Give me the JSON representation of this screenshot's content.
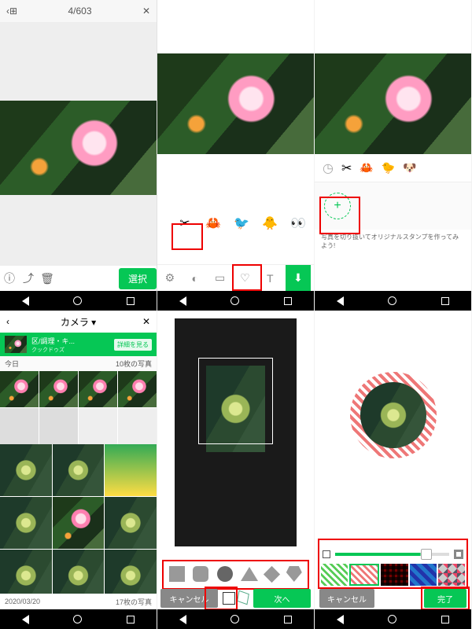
{
  "p1": {
    "counter": "4/603",
    "select": "選択"
  },
  "p4": {
    "title": "カメラ ▾",
    "banner_title": "区/調理・キ...",
    "banner_sub": "クックドゥズ",
    "detail": "詳細を見る",
    "section_a": "今日",
    "section_a_count": "10枚の写真",
    "date": "2020/03/20",
    "date_count": "17枚の写真"
  },
  "p3": {
    "hint": "写真を切り抜いてオリジナルスタンプを作ってみよう!"
  },
  "p5": {
    "cancel": "キャンセル",
    "next": "次へ"
  },
  "p6": {
    "cancel": "キャンセル",
    "done": "完了"
  }
}
